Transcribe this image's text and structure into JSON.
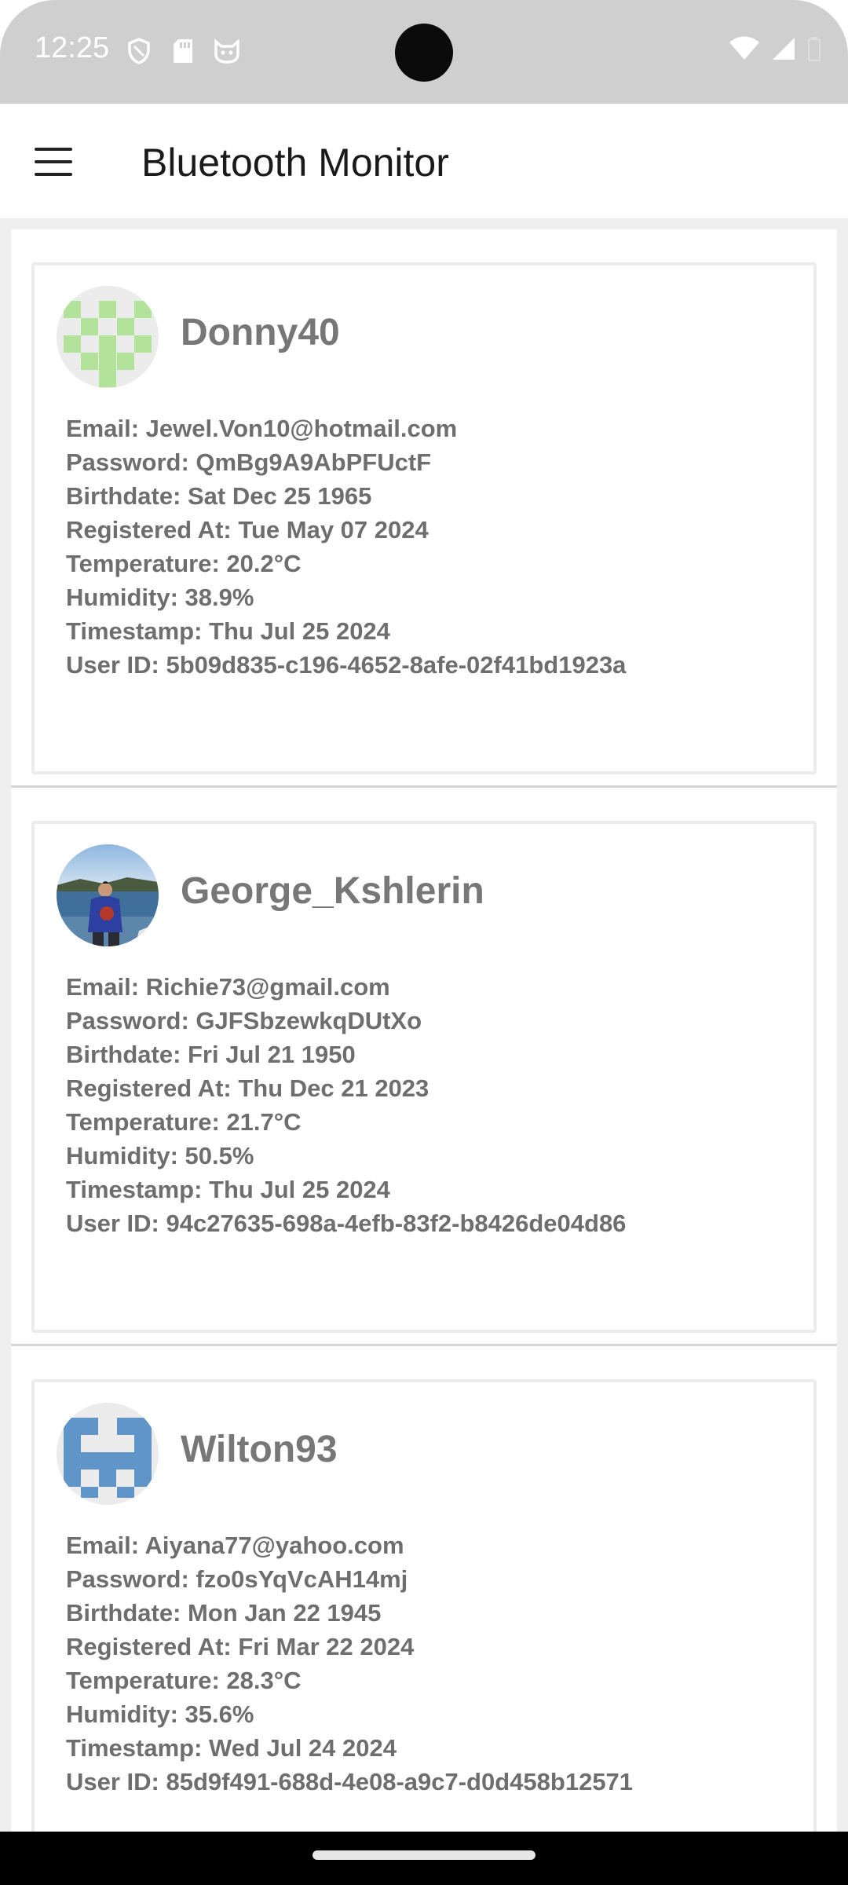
{
  "status_bar": {
    "time": "12:25",
    "left_icons": [
      "shield-icon",
      "sd-card-icon",
      "cat-face-icon"
    ],
    "right_icons": [
      "wifi-icon",
      "signal-icon",
      "battery-icon"
    ]
  },
  "app_bar": {
    "title": "Bluetooth Monitor",
    "menu_icon": "hamburger-menu-icon"
  },
  "users": [
    {
      "username": "Donny40",
      "avatar": "identicon-green",
      "email": "Email: Jewel.Von10@hotmail.com",
      "password": "Password: QmBg9A9AbPFUctF",
      "birthdate": "Birthdate: Sat Dec 25 1965",
      "registered": "Registered At: Tue May 07 2024",
      "temperature": "Temperature: 20.2°C",
      "humidity": "Humidity: 38.9%",
      "timestamp": "Timestamp: Thu Jul 25 2024",
      "user_id": "User ID: 5b09d835-c196-4652-8afe-02f41bd1923a"
    },
    {
      "username": "George_Kshlerin",
      "avatar": "photo-person-lake",
      "email": "Email: Richie73@gmail.com",
      "password": "Password: GJFSbzewkqDUtXo",
      "birthdate": "Birthdate: Fri Jul 21 1950",
      "registered": "Registered At: Thu Dec 21 2023",
      "temperature": "Temperature: 21.7°C",
      "humidity": "Humidity: 50.5%",
      "timestamp": "Timestamp: Thu Jul 25 2024",
      "user_id": "User ID: 94c27635-698a-4efb-83f2-b8426de04d86"
    },
    {
      "username": "Wilton93",
      "avatar": "identicon-blue",
      "email": "Email: Aiyana77@yahoo.com",
      "password": "Password: fzo0sYqVcAH14mj",
      "birthdate": "Birthdate: Mon Jan 22 1945",
      "registered": "Registered At: Fri Mar 22 2024",
      "temperature": "Temperature: 28.3°C",
      "humidity": "Humidity: 35.6%",
      "timestamp": "Timestamp: Wed Jul 24 2024",
      "user_id": "User ID: 85d9f491-688d-4e08-a9c7-d0d458b12571"
    }
  ],
  "colors": {
    "identicon_green": "#b3e39a",
    "identicon_blue": "#5f95c9",
    "status_bar_bg": "#cfcfcf",
    "content_bg": "#efefef"
  }
}
